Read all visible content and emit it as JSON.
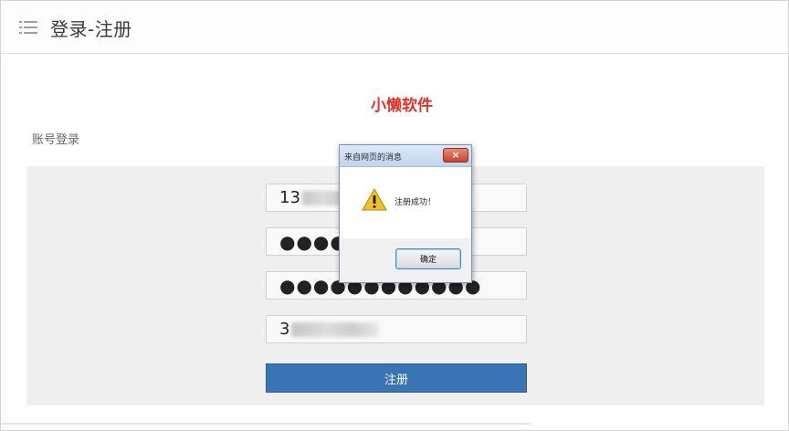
{
  "header": {
    "title": "登录-注册",
    "menu_icon": "hamburger-list-icon"
  },
  "brand": {
    "name": "小懒软件",
    "color": "#e0322b"
  },
  "form": {
    "section_label": "账号登录",
    "fields": [
      {
        "name": "phone",
        "value": "13"
      },
      {
        "name": "password",
        "value": "●●●●●"
      },
      {
        "name": "confirm-password",
        "value": "●●●●●●●●●●●●"
      },
      {
        "name": "verification-code",
        "value": "3"
      }
    ],
    "submit_label": "注册",
    "submit_color": "#3a74b4"
  },
  "dialog": {
    "title": "来自网页的消息",
    "message": "注册成功！",
    "ok_label": "确定",
    "icon": "warning-icon",
    "close_label": "×"
  }
}
